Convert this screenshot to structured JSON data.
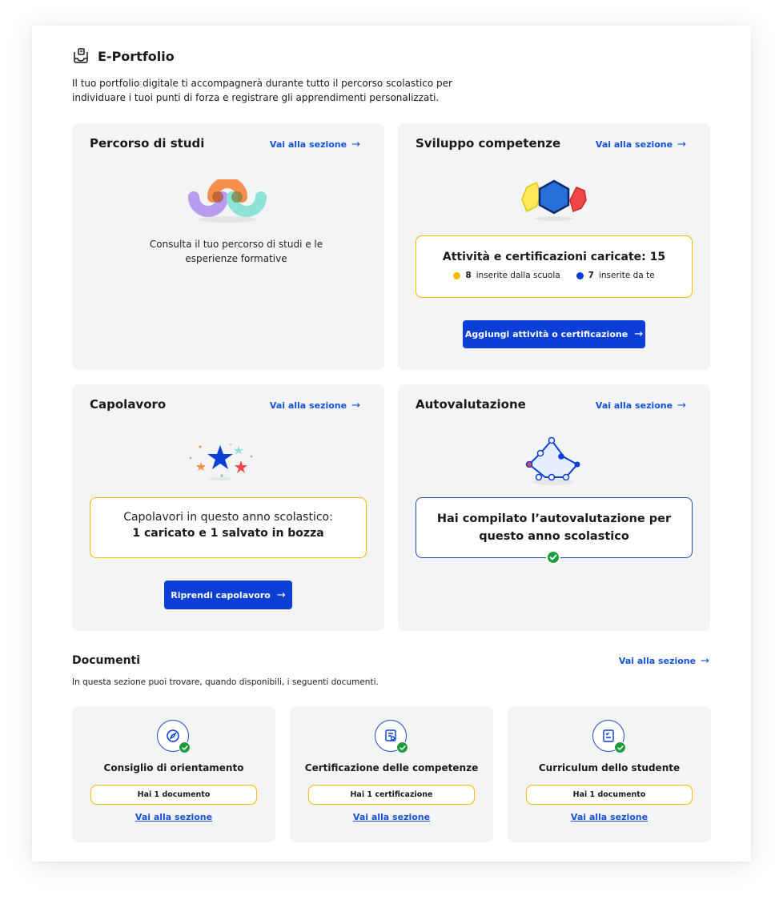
{
  "header": {
    "title": "E-Portfolio",
    "intro_line1": "Il tuo portfolio digitale ti accompagnerà durante tutto il percorso scolastico per",
    "intro_line2": "individuare i tuoi punti di forza e registrare gli apprendimenti personalizzati."
  },
  "link_label": "Vai alla sezione",
  "arrow": "→",
  "cards": {
    "percorso": {
      "title": "Percorso di studi",
      "text_line1": "Consulta il tuo percorso di studi e le",
      "text_line2": "esperienze formative"
    },
    "sviluppo": {
      "title": "Sviluppo competenze",
      "stat_title": "Attività e certificazioni caricate: 15",
      "school_count": "8",
      "school_label": "inserite dalla scuola",
      "own_count": "7",
      "own_label": "inserite da te",
      "button": "Aggiungi attività o certificazione"
    },
    "capolavoro": {
      "title": "Capolavoro",
      "line1": "Capolavori in questo anno scolastico:",
      "line2": "1 caricato e 1 salvato in bozza",
      "button": "Riprendi capolavoro"
    },
    "autovalutazione": {
      "title": "Autovalutazione",
      "line1": "Hai compilato l’autovalutazione per",
      "line2": "questo anno scolastico"
    }
  },
  "documenti": {
    "title": "Documenti",
    "description": "In questa sezione puoi trovare, quando disponibili, i seguenti documenti.",
    "items": [
      {
        "name": "Consiglio di orientamento",
        "status": "Hai 1 documento",
        "icon": "compass-icon"
      },
      {
        "name": "Certificazione delle competenze",
        "status": "Hai 1 certificazione",
        "icon": "certificate-icon"
      },
      {
        "name": "Curriculum dello studente",
        "status": "Hai 1 documento",
        "icon": "curriculum-icon"
      }
    ]
  },
  "colors": {
    "accent_blue": "#0b3fd6",
    "link_blue": "#1552d8",
    "highlight_yellow": "#f6b800",
    "success_green": "#1a9e3e",
    "card_bg": "#f3f4f6"
  }
}
